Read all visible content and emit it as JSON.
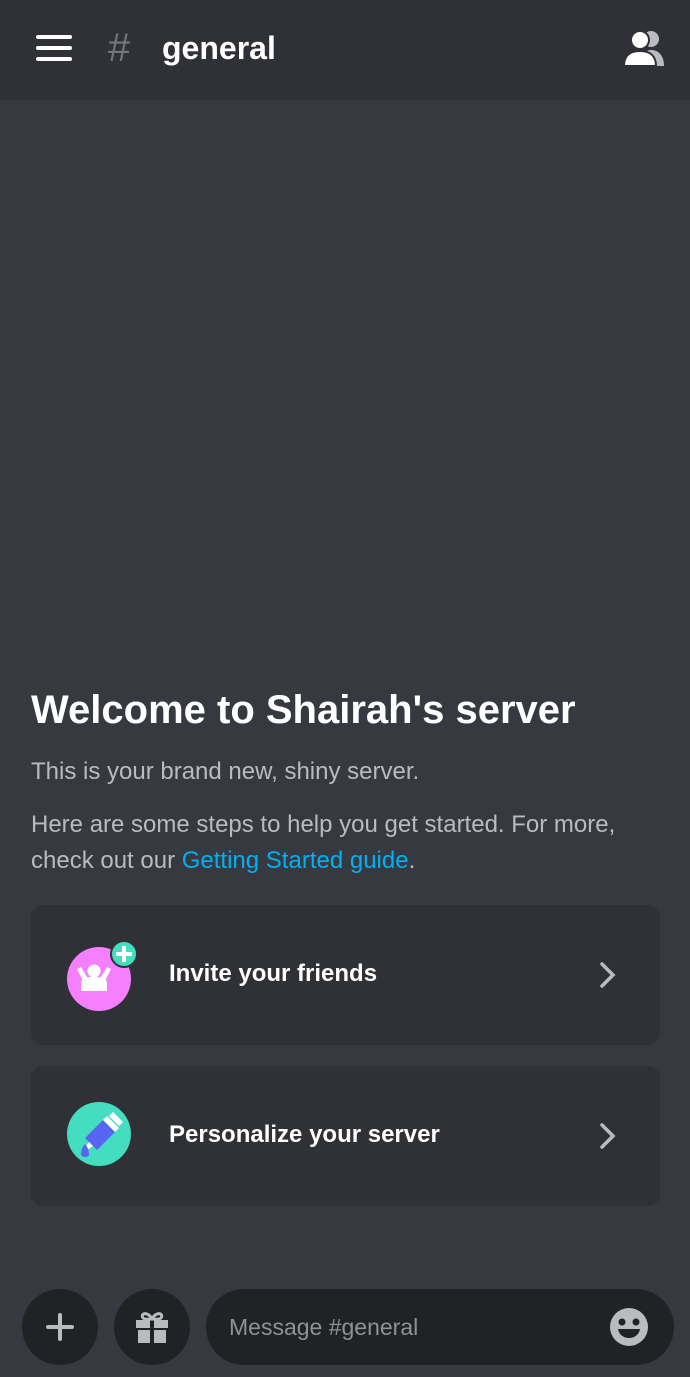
{
  "header": {
    "hash_symbol": "#",
    "channel_name": "general",
    "menu_icon": "hamburger-menu-icon",
    "members_icon": "members-icon"
  },
  "welcome": {
    "title": "Welcome to Shairah's server",
    "subtitle": "This is your brand new, shiny server.",
    "steps_text": "Here are some steps to help you get started. For more, check out our ",
    "guide_link": "Getting Started guide",
    "steps_suffix": "."
  },
  "cards": [
    {
      "label": "Invite your friends",
      "icon": "invite-friends-icon",
      "icon_color": "#f47fff",
      "badge_color": "#45ddc0"
    },
    {
      "label": "Personalize your server",
      "icon": "personalize-brush-icon",
      "icon_color": "#45ddc0",
      "accent_color": "#5865f2"
    }
  ],
  "composer": {
    "add_icon": "plus-icon",
    "gift_icon": "gift-icon",
    "placeholder": "Message #general",
    "emoji_icon": "emoji-icon"
  },
  "colors": {
    "background": "#36393f",
    "header_bg": "#2f3136",
    "link": "#00b0f4",
    "muted_text": "#b9bbbe"
  }
}
